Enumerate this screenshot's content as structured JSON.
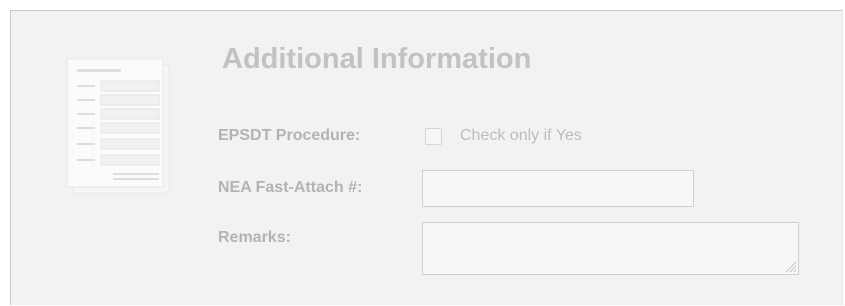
{
  "section": {
    "title": "Additional Information",
    "icon": "document-form-icon"
  },
  "fields": {
    "epsdt": {
      "label": "EPSDT Procedure:",
      "checkbox_text": "Check only if Yes",
      "checked": false
    },
    "nea": {
      "label": "NEA Fast-Attach #:",
      "value": ""
    },
    "remarks": {
      "label": "Remarks:",
      "value": ""
    }
  },
  "colors": {
    "panel_background": "#f2f2f2",
    "title_text": "#c2c2c2",
    "label_text": "#b3b3b3",
    "input_border": "#cfcfcf"
  }
}
